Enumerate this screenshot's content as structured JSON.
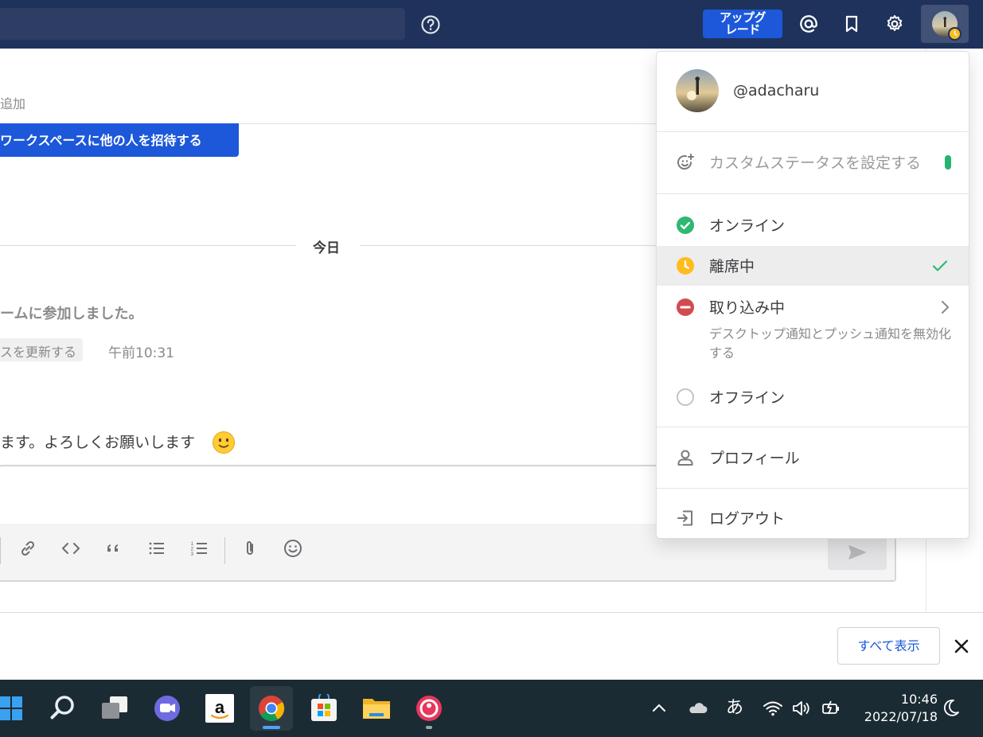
{
  "topbar": {
    "upgrade_label_1": "アップグ",
    "upgrade_label_2": "レード"
  },
  "main": {
    "add_text": "追加",
    "invite_button": "ワークスペースに他の人を招待する",
    "date_separator": "今日",
    "system_message": "ームに参加しました。",
    "status_chip": "スを更新する",
    "timestamp": "午前10:31",
    "message_text": "ます。よろしくお願いします"
  },
  "menu": {
    "username": "@adacharu",
    "custom_status": "カスタムステータスを設定する",
    "online": "オンライン",
    "away": "離席中",
    "dnd": "取り込み中",
    "dnd_description": "デスクトップ通知とプッシュ通知を無効化する",
    "offline": "オフライン",
    "profile": "プロフィール",
    "logout": "ログアウト"
  },
  "notification": {
    "show_all": "すべて表示"
  },
  "taskbar": {
    "ime_label": "あ",
    "time": "10:46",
    "date": "2022/07/18"
  },
  "colors": {
    "topbar": "#1e325c",
    "accent": "#1c58d9",
    "online": "#2eb872",
    "away": "#ffbc1f",
    "dnd": "#d24b4e"
  }
}
